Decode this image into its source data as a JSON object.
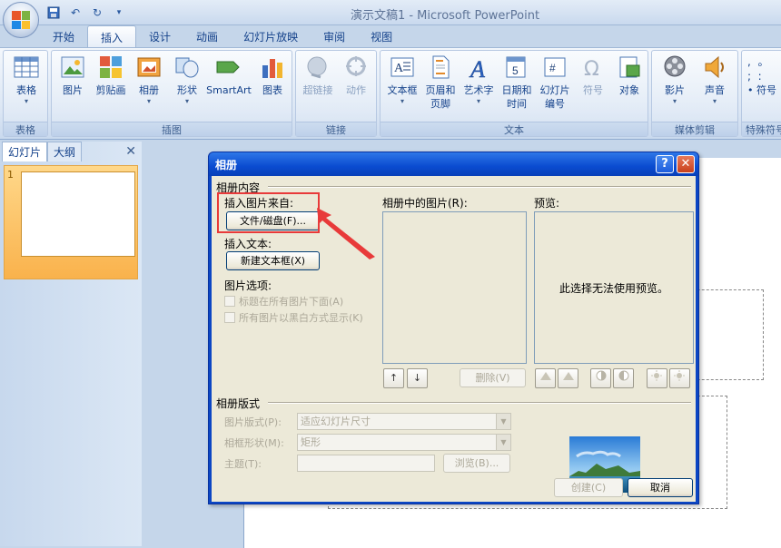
{
  "window": {
    "title": "演示文稿1 - Microsoft PowerPoint"
  },
  "ribbon_tabs": [
    "开始",
    "插入",
    "设计",
    "动画",
    "幻灯片放映",
    "审阅",
    "视图"
  ],
  "ribbon": {
    "groups": {
      "table": "表格",
      "illustrations": "插图",
      "links": "链接",
      "text": "文本",
      "media": "媒体剪辑",
      "symbols": "特殊符号"
    },
    "buttons": {
      "table": "表格",
      "picture": "图片",
      "clipart": "剪贴画",
      "album": "相册",
      "shapes": "形状",
      "smartart": "SmartArt",
      "chart": "图表",
      "hyperlink": "超链接",
      "action": "动作",
      "textbox": "文本框",
      "header_footer_1": "页眉和",
      "header_footer_2": "页脚",
      "wordart": "艺术字",
      "datetime_1": "日期和",
      "datetime_2": "时间",
      "slide_number_1": "幻灯片",
      "slide_number_2": "编号",
      "symbol": "符号",
      "object": "对象",
      "movie": "影片",
      "sound": "声音",
      "special_symbol": "符号"
    }
  },
  "left_panel": {
    "tabs": [
      "幻灯片",
      "大纲"
    ],
    "close": "✕",
    "slide_number": "1"
  },
  "dialog": {
    "title": "相册",
    "help": "?",
    "close": "✕",
    "album_content": "相册内容",
    "insert_picture_from": "插入图片来自:",
    "file_disk_button": "文件/磁盘(F)...",
    "insert_text": "插入文本:",
    "new_textbox_button": "新建文本框(X)",
    "picture_options": "图片选项:",
    "caption_below": "标题在所有图片下面(A)",
    "all_black_white": "所有图片以黑白方式显示(K)",
    "pictures_in_album": "相册中的图片(R):",
    "preview_label": "预览:",
    "preview_message": "此选择无法使用预览。",
    "move_up": "↑",
    "move_down": "↓",
    "delete_button": "删除(V)",
    "album_layout": "相册版式",
    "picture_layout_label": "图片版式(P):",
    "picture_layout_value": "适应幻灯片尺寸",
    "frame_shape_label": "相框形状(M):",
    "frame_shape_value": "矩形",
    "theme_label": "主题(T):",
    "browse_button": "浏览(B)...",
    "create_button": "创建(C)",
    "cancel_button": "取消"
  }
}
